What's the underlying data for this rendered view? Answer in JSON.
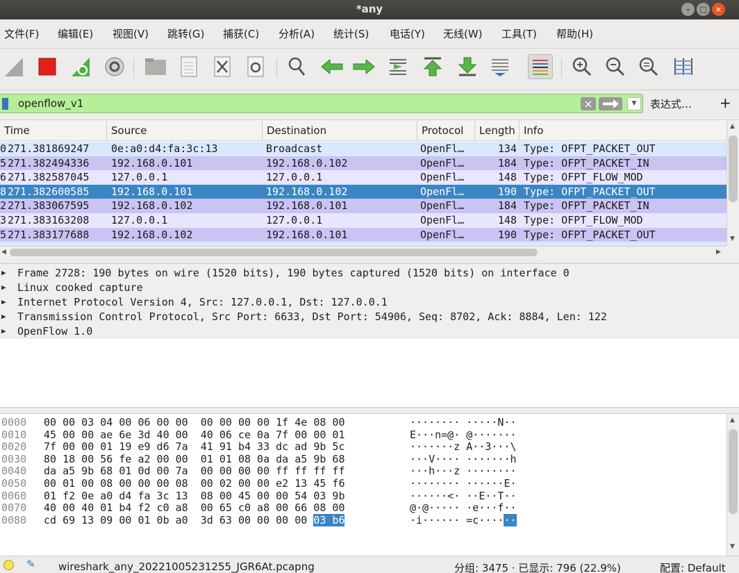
{
  "window": {
    "title": "*any"
  },
  "menu": [
    "文件(F)",
    "编辑(E)",
    "视图(V)",
    "跳转(G)",
    "捕获(C)",
    "分析(A)",
    "统计(S)",
    "电话(Y)",
    "无线(W)",
    "工具(T)",
    "帮助(H)"
  ],
  "filter": {
    "value": "openflow_v1",
    "expression_label": "表达式…",
    "add_label": "+"
  },
  "packet_list": {
    "columns": [
      "Time",
      "Source",
      "Destination",
      "Protocol",
      "Length",
      "Info"
    ],
    "rows": [
      {
        "no": "0",
        "time": "271.381869247",
        "source": "0e:a0:d4:fa:3c:13",
        "destination": "Broadcast",
        "protocol": "OpenFl…",
        "length": "134",
        "info": "Type: OFPT_PACKET_OUT"
      },
      {
        "no": "5",
        "time": "271.382494336",
        "source": "192.168.0.101",
        "destination": "192.168.0.102",
        "protocol": "OpenFl…",
        "length": "184",
        "info": "Type: OFPT_PACKET_IN"
      },
      {
        "no": "6",
        "time": "271.382587045",
        "source": "127.0.0.1",
        "destination": "127.0.0.1",
        "protocol": "OpenFl…",
        "length": "148",
        "info": "Type: OFPT_FLOW_MOD"
      },
      {
        "no": "8",
        "time": "271.382600585",
        "source": "192.168.0.101",
        "destination": "192.168.0.102",
        "protocol": "OpenFl…",
        "length": "190",
        "info": "Type: OFPT_PACKET_OUT"
      },
      {
        "no": "2",
        "time": "271.383067595",
        "source": "192.168.0.102",
        "destination": "192.168.0.101",
        "protocol": "OpenFl…",
        "length": "184",
        "info": "Type: OFPT_PACKET_IN"
      },
      {
        "no": "3",
        "time": "271.383163208",
        "source": "127.0.0.1",
        "destination": "127.0.0.1",
        "protocol": "OpenFl…",
        "length": "148",
        "info": "Type: OFPT_FLOW_MOD"
      },
      {
        "no": "5",
        "time": "271.383177688",
        "source": "192.168.0.102",
        "destination": "192.168.0.101",
        "protocol": "OpenFl…",
        "length": "190",
        "info": "Type: OFPT_PACKET_OUT"
      }
    ]
  },
  "details": [
    "Frame 2728: 190 bytes on wire (1520 bits), 190 bytes captured (1520 bits) on interface 0",
    "Linux cooked capture",
    "Internet Protocol Version 4, Src: 127.0.0.1, Dst: 127.0.0.1",
    "Transmission Control Protocol, Src Port: 6633, Dst Port: 54906, Seq: 8702, Ack: 8884, Len: 122",
    "OpenFlow 1.0"
  ],
  "bytes": [
    {
      "offset": "0000",
      "hex": "00 00 03 04 00 06 00 00  00 00 00 00 1f 4e 08 00",
      "ascii": "········ ·····N··"
    },
    {
      "offset": "0010",
      "hex": "45 00 00 ae 6e 3d 40 00  40 06 ce 0a 7f 00 00 01",
      "ascii": "E···n=@· @·······"
    },
    {
      "offset": "0020",
      "hex": "7f 00 00 01 19 e9 d6 7a  41 91 b4 33 dc ad 9b 5c",
      "ascii": "·······z A··3···\\"
    },
    {
      "offset": "0030",
      "hex": "80 18 00 56 fe a2 00 00  01 01 08 0a da a5 9b 68",
      "ascii": "···V···· ·······h"
    },
    {
      "offset": "0040",
      "hex": "da a5 9b 68 01 0d 00 7a  00 00 00 00 ff ff ff ff",
      "ascii": "···h···z ········"
    },
    {
      "offset": "0050",
      "hex": "00 01 00 08 00 00 00 08  00 02 00 00 e2 13 45 f6",
      "ascii": "········ ······E·"
    },
    {
      "offset": "0060",
      "hex": "01 f2 0e a0 d4 fa 3c 13  08 00 45 00 00 54 03 9b",
      "ascii": "······<· ··E··T··"
    },
    {
      "offset": "0070",
      "hex": "40 00 40 01 b4 f2 c0 a8  00 65 c0 a8 00 66 08 00",
      "ascii": "@·@····· ·e···f··"
    },
    {
      "offset": "0080",
      "hex": "cd 69 13 09 00 01 0b a0  3d 63 00 00 00 00 ",
      "hex_sel": "03 b6",
      "ascii": "·i······ =c····",
      "ascii_sel": "··"
    }
  ],
  "status": {
    "file": "wireshark_any_20221005231255_JGR6At.pcapng",
    "packets": "分组: 3475 · 已显示: 796 (22.9%)",
    "profile": "配置: Default"
  },
  "colors": {
    "filter_ok": "#b5ef9a",
    "row_blue": "#d9e8ff",
    "row_purple": "#c9c4f2",
    "row_light": "#e7e6ff",
    "selected": "#3a85c4",
    "capture_stop": "#e0201b"
  }
}
